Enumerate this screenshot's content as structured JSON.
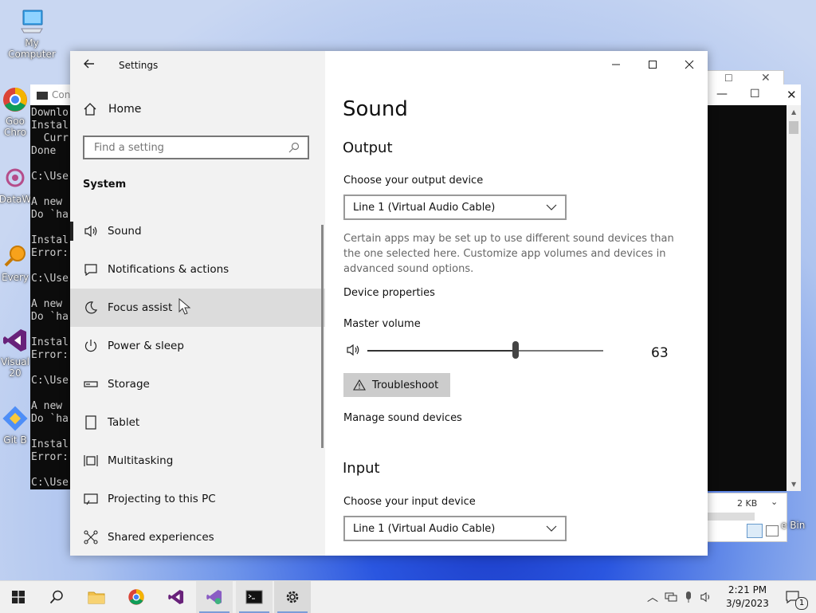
{
  "desktop": {
    "icons": [
      {
        "label": "My Computer"
      },
      {
        "label": "Goo\nChro"
      },
      {
        "label": "DataW"
      },
      {
        "label": "Every"
      },
      {
        "label": "Visual\n20"
      },
      {
        "label": "Git B"
      }
    ],
    "recycle_bin_label": "e Bin"
  },
  "terminal": {
    "title": "Con",
    "lines": "Downlo\nInstal\n  Curr\nDone\n\nC:\\Use\n\nA new\nDo `ha\n\nInstal\nError:\n\nC:\\Use\n\nA new\nDo `ha\n\nInstal\nError:\n\nC:\\Use\n\nA new\nDo `ha\n\nInstal\nError:\n\nC:\\Use"
  },
  "explorer_strip": {
    "size": "2 KB"
  },
  "settings": {
    "window_title": "Settings",
    "home_label": "Home",
    "search_placeholder": "Find a setting",
    "category": "System",
    "nav": [
      {
        "label": "Sound",
        "icon": "speaker-icon"
      },
      {
        "label": "Notifications & actions",
        "icon": "notification-icon"
      },
      {
        "label": "Focus assist",
        "icon": "moon-icon"
      },
      {
        "label": "Power & sleep",
        "icon": "power-icon"
      },
      {
        "label": "Storage",
        "icon": "storage-icon"
      },
      {
        "label": "Tablet",
        "icon": "tablet-icon"
      },
      {
        "label": "Multitasking",
        "icon": "multitasking-icon"
      },
      {
        "label": "Projecting to this PC",
        "icon": "projecting-icon"
      },
      {
        "label": "Shared experiences",
        "icon": "shared-icon"
      }
    ],
    "page": {
      "title": "Sound",
      "output_heading": "Output",
      "output_device_label": "Choose your output device",
      "output_device_value": "Line 1 (Virtual Audio Cable)",
      "output_description": "Certain apps may be set up to use different sound devices than the one selected here. Customize app volumes and devices in advanced sound options.",
      "device_properties": "Device properties",
      "master_volume_label": "Master volume",
      "master_volume_value": "63",
      "master_volume_level": 63,
      "troubleshoot_label": "Troubleshoot",
      "manage_devices": "Manage sound devices",
      "input_heading": "Input",
      "input_device_label": "Choose your input device",
      "input_device_value": "Line 1 (Virtual Audio Cable)"
    }
  },
  "taskbar": {
    "time": "2:21 PM",
    "date": "3/9/2023",
    "notification_count": "1"
  }
}
